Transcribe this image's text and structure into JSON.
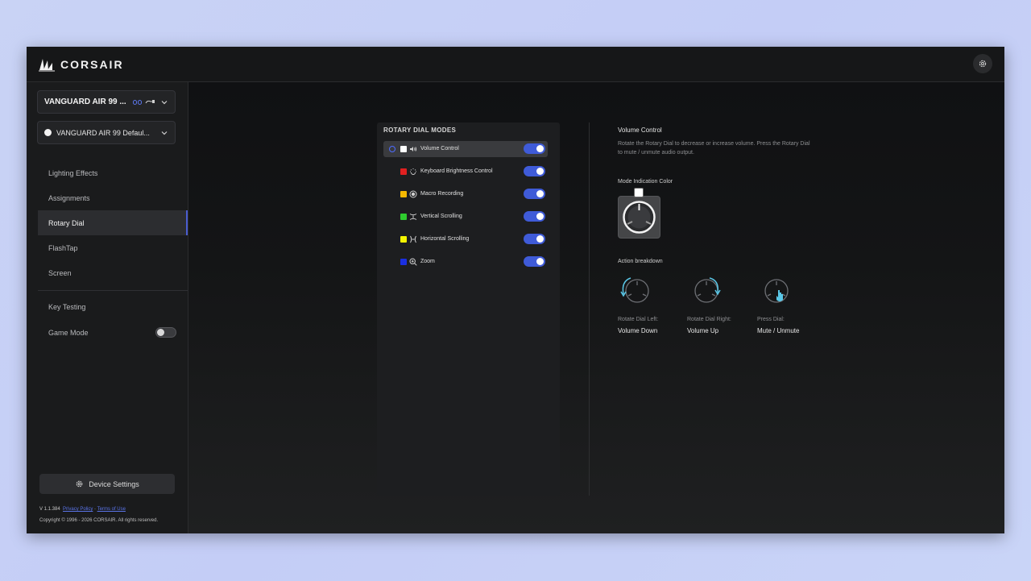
{
  "app": {
    "brand": "CORSAIR",
    "settings_icon": "gear-icon"
  },
  "sidebar": {
    "device": {
      "name": "VANGUARD AIR 99 ...",
      "icons": [
        "wireless-icon",
        "usb-icon",
        "chevron-down-icon"
      ]
    },
    "profile": {
      "name": "VANGUARD AIR 99 Defaul...",
      "dot_color": "#f2f2f2"
    },
    "nav_items": [
      {
        "label": "Lighting Effects",
        "active": false
      },
      {
        "label": "Assignments",
        "active": false
      },
      {
        "label": "Rotary Dial",
        "active": true
      },
      {
        "label": "FlashTap",
        "active": false
      },
      {
        "label": "Screen",
        "active": false
      }
    ],
    "secondary_items": [
      {
        "label": "Key Testing"
      },
      {
        "label": "Game Mode",
        "toggle": false
      }
    ],
    "device_settings_label": "Device Settings",
    "version": "V 1.1.384",
    "privacy_policy": "Privacy Policy",
    "separator": "·",
    "terms": "Terms of Use",
    "copyright": "Copyright © 1996 - 2026 CORSAIR. All rights reserved."
  },
  "modes": {
    "title": "ROTARY DIAL MODES",
    "items": [
      {
        "label": "Volume Control",
        "color": "#ffffff",
        "icon": "speaker-icon",
        "enabled": true,
        "selected": true
      },
      {
        "label": "Keyboard Brightness Control",
        "color": "#e02020",
        "icon": "brightness-icon",
        "enabled": true,
        "selected": false
      },
      {
        "label": "Macro Recording",
        "color": "#f5b800",
        "icon": "record-icon",
        "enabled": true,
        "selected": false
      },
      {
        "label": "Vertical Scrolling",
        "color": "#2ecc2e",
        "icon": "vertical-scroll-icon",
        "enabled": true,
        "selected": false
      },
      {
        "label": "Horizontal Scrolling",
        "color": "#f5f500",
        "icon": "horizontal-scroll-icon",
        "enabled": true,
        "selected": false
      },
      {
        "label": "Zoom",
        "color": "#1a2fe0",
        "icon": "zoom-icon",
        "enabled": true,
        "selected": false
      }
    ],
    "accent": "#3f5bd8"
  },
  "detail": {
    "title": "Volume Control",
    "description": "Rotate the Rotary Dial to decrease or increase volume. Press the Rotary Dial to mute / unmute audio output.",
    "mode_indication_label": "Mode Indication Color",
    "mode_color": "#ffffff",
    "action_breakdown_label": "Action breakdown",
    "actions": [
      {
        "caption": "Rotate Dial Left:",
        "value": "Volume Down",
        "icon": "rotate-left-icon"
      },
      {
        "caption": "Rotate Dial Right:",
        "value": "Volume Up",
        "icon": "rotate-right-icon"
      },
      {
        "caption": "Press Dial:",
        "value": "Mute / Unmute",
        "icon": "press-dial-icon"
      }
    ]
  }
}
